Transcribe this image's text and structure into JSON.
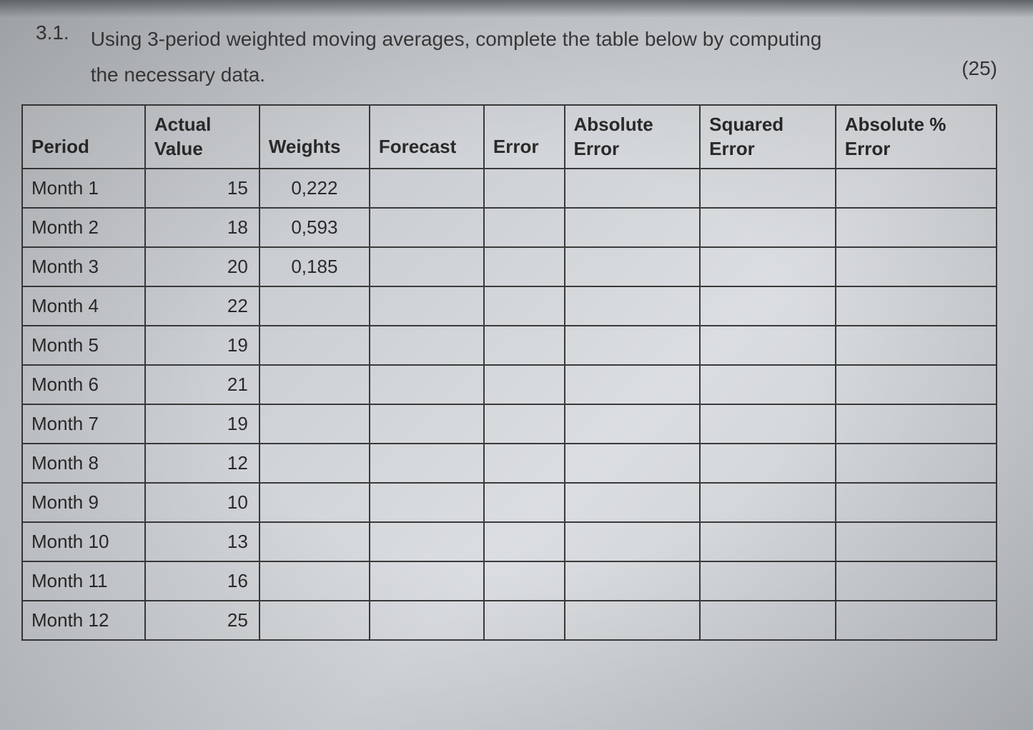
{
  "question": {
    "number": "3.1.",
    "text_line1": "Using 3-period weighted moving averages, complete the table below by computing",
    "text_line2": "the necessary data.",
    "marks": "(25)"
  },
  "table": {
    "headers": {
      "period": "Period",
      "actual_top": "Actual",
      "actual_bottom": "Value",
      "weights": "Weights",
      "forecast": "Forecast",
      "error": "Error",
      "abs_top": "Absolute",
      "abs_bottom": "Error",
      "sq_top": "Squared",
      "sq_bottom": "Error",
      "pct_top": "Absolute %",
      "pct_bottom": "Error"
    },
    "chart_data": {
      "type": "table",
      "columns": [
        "Period",
        "Actual Value",
        "Weights",
        "Forecast",
        "Error",
        "Absolute Error",
        "Squared Error",
        "Absolute % Error"
      ],
      "rows": [
        {
          "period": "Month 1",
          "actual": 15,
          "weights": "0,222",
          "forecast": "",
          "error": "",
          "abs": "",
          "sq": "",
          "pct": ""
        },
        {
          "period": "Month 2",
          "actual": 18,
          "weights": "0,593",
          "forecast": "",
          "error": "",
          "abs": "",
          "sq": "",
          "pct": ""
        },
        {
          "period": "Month 3",
          "actual": 20,
          "weights": "0,185",
          "forecast": "",
          "error": "",
          "abs": "",
          "sq": "",
          "pct": ""
        },
        {
          "period": "Month 4",
          "actual": 22,
          "weights": "",
          "forecast": "",
          "error": "",
          "abs": "",
          "sq": "",
          "pct": ""
        },
        {
          "period": "Month 5",
          "actual": 19,
          "weights": "",
          "forecast": "",
          "error": "",
          "abs": "",
          "sq": "",
          "pct": ""
        },
        {
          "period": "Month 6",
          "actual": 21,
          "weights": "",
          "forecast": "",
          "error": "",
          "abs": "",
          "sq": "",
          "pct": ""
        },
        {
          "period": "Month 7",
          "actual": 19,
          "weights": "",
          "forecast": "",
          "error": "",
          "abs": "",
          "sq": "",
          "pct": ""
        },
        {
          "period": "Month 8",
          "actual": 12,
          "weights": "",
          "forecast": "",
          "error": "",
          "abs": "",
          "sq": "",
          "pct": ""
        },
        {
          "period": "Month 9",
          "actual": 10,
          "weights": "",
          "forecast": "",
          "error": "",
          "abs": "",
          "sq": "",
          "pct": ""
        },
        {
          "period": "Month 10",
          "actual": 13,
          "weights": "",
          "forecast": "",
          "error": "",
          "abs": "",
          "sq": "",
          "pct": ""
        },
        {
          "period": "Month 11",
          "actual": 16,
          "weights": "",
          "forecast": "",
          "error": "",
          "abs": "",
          "sq": "",
          "pct": ""
        },
        {
          "period": "Month 12",
          "actual": 25,
          "weights": "",
          "forecast": "",
          "error": "",
          "abs": "",
          "sq": "",
          "pct": ""
        }
      ]
    }
  }
}
